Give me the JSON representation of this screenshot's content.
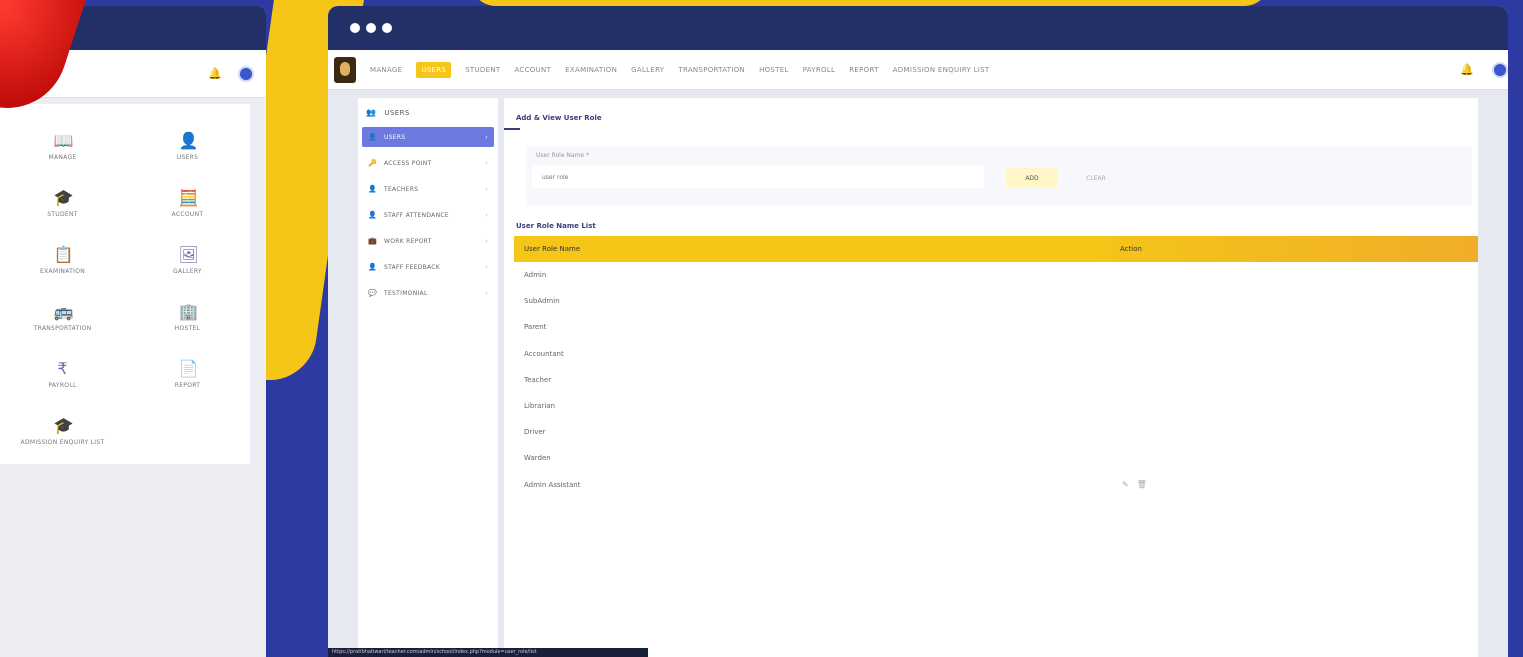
{
  "colors": {
    "accent_yellow": "#f5c518",
    "navy": "#233067",
    "bg_blue": "#2d3aa1",
    "sidebar_active": "#6c7ae0"
  },
  "left_panel": {
    "tiles": [
      {
        "label": "MANAGE",
        "icon": "book-icon"
      },
      {
        "label": "USERS",
        "icon": "user-icon"
      },
      {
        "label": "STUDENT",
        "icon": "graduation-cap-icon"
      },
      {
        "label": "ACCOUNT",
        "icon": "calculator-icon"
      },
      {
        "label": "EXAMINATION",
        "icon": "clipboard-icon"
      },
      {
        "label": "GALLERY",
        "icon": "image-icon"
      },
      {
        "label": "TRANSPORTATION",
        "icon": "bus-icon"
      },
      {
        "label": "HOSTEL",
        "icon": "building-icon"
      },
      {
        "label": "PAYROLL",
        "icon": "rupee-icon"
      },
      {
        "label": "REPORT",
        "icon": "report-icon"
      },
      {
        "label": "ADMISSION ENQUIRY LIST",
        "icon": "graduation-cap-icon"
      }
    ]
  },
  "topnav": {
    "items": [
      "MANAGE",
      "USERS",
      "STUDENT",
      "ACCOUNT",
      "EXAMINATION",
      "GALLERY",
      "TRANSPORTATION",
      "HOSTEL",
      "PAYROLL",
      "REPORT",
      "ADMISSION ENQUIRY LIST"
    ],
    "active": "USERS"
  },
  "sidebar": {
    "header": "USERS",
    "items": [
      {
        "label": "USERS",
        "icon": "user-icon",
        "active": true
      },
      {
        "label": "ACCESS POINT",
        "icon": "key-icon",
        "active": false
      },
      {
        "label": "TEACHERS",
        "icon": "person-icon",
        "active": false
      },
      {
        "label": "STAFF ATTENDANCE",
        "icon": "person-icon",
        "active": false
      },
      {
        "label": "WORK REPORT",
        "icon": "briefcase-icon",
        "active": false
      },
      {
        "label": "STAFF FEEDBACK",
        "icon": "person-icon",
        "active": false
      },
      {
        "label": "TESTIMONIAL",
        "icon": "chat-icon",
        "active": false
      }
    ]
  },
  "content": {
    "title": "Add & View User Role",
    "form": {
      "label": "User Role Name *",
      "placeholder": "user role",
      "add_label": "ADD",
      "clear_label": "CLEAR"
    },
    "list_title": "User Role Name List",
    "table": {
      "headers": [
        "User Role Name",
        "Action"
      ],
      "rows": [
        "Admin",
        "SubAdmin",
        "Parent",
        "Accountant",
        "Teacher",
        "Librarian",
        "Driver",
        "Warden",
        "Admin Assistant"
      ],
      "row_with_actions": 8
    }
  },
  "status_url": "https://pratibhatiwari/teacher.com/admin/school/index.php?module=user_role/list"
}
